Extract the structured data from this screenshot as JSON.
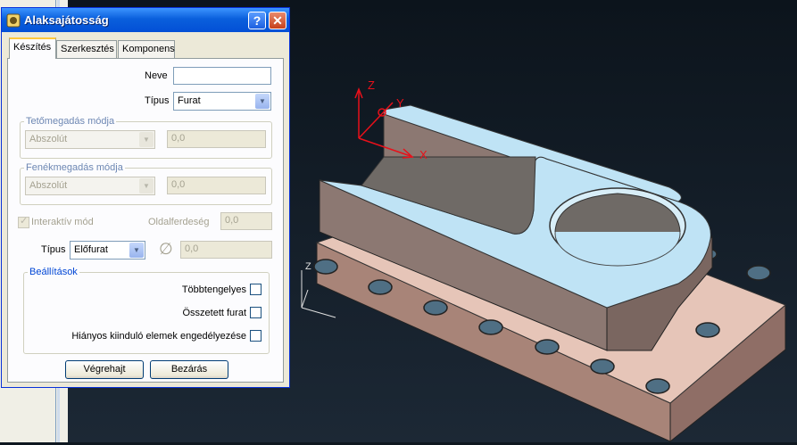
{
  "dialog": {
    "title": "Alaksajátosság",
    "help_label": "?",
    "close_label": "✕",
    "tabs": [
      "Készítés",
      "Szerkesztés",
      "Komponens"
    ],
    "fields": {
      "neve_label": "Neve",
      "neve_value": "",
      "tipus_label": "Típus",
      "tipus_value": "Furat",
      "top_group": "Tetőmegadás módja",
      "top_mode": "Abszolút",
      "top_value": "0,0",
      "bottom_group": "Fenékmegadás módja",
      "bottom_mode": "Abszolút",
      "bottom_value": "0,0",
      "interactive_label": "Interaktív mód",
      "interactive_checked": true,
      "side_label": "Oldalferdeség",
      "side_value": "0,0",
      "type2_label": "Típus",
      "type2_value": "Előfurat",
      "diameter_symbol": "∅",
      "diameter_value": "0,0"
    },
    "settings": {
      "group": "Beállítások",
      "items": [
        {
          "label": "Többtengelyes",
          "checked": false
        },
        {
          "label": "Összetett furat",
          "checked": false
        },
        {
          "label": "Hiányos kiinduló elemek engedélyezése",
          "checked": false
        }
      ]
    },
    "buttons": {
      "execute": "Végrehajt",
      "close": "Bezárás"
    }
  },
  "viewport": {
    "axis_labels": {
      "z": "Z",
      "x": "X",
      "y": "Y",
      "z2": "Z"
    },
    "colors": {
      "background": "#0f1820",
      "top_face": "#bfe3f5",
      "side_face": "#8c7872",
      "base_face": "#e8c6b8",
      "axis": "#e8101a"
    }
  }
}
